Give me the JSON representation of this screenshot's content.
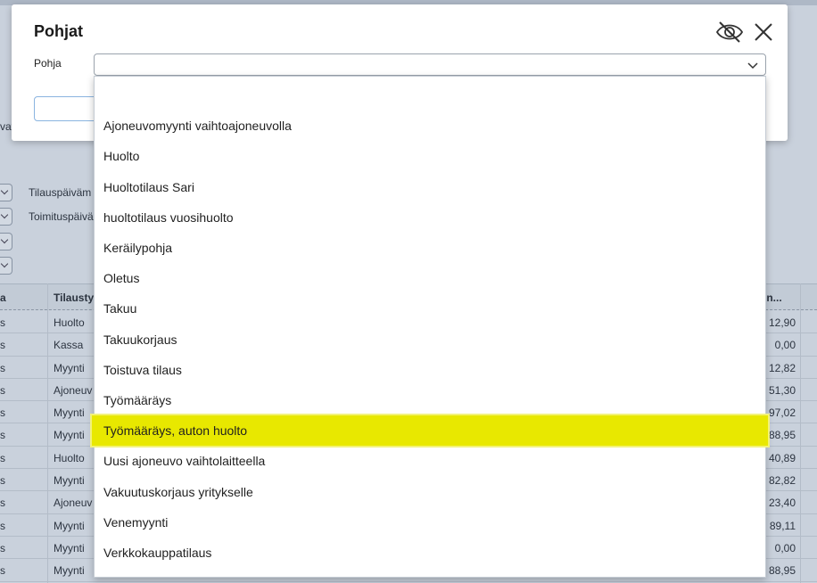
{
  "modal": {
    "title": "Pohjat",
    "field_label": "Pohja",
    "selected_value": "",
    "hide_icon": "eye-off-icon",
    "close_icon": "close-icon"
  },
  "dropdown": {
    "items": [
      "",
      "Ajoneuvomyynti vaihtoajoneuvolla",
      "Huolto",
      "Huoltotilaus Sari",
      "huoltotilaus vuosihuolto",
      "Keräilypohja",
      "Oletus",
      "Takuu",
      "Takuukorjaus",
      "Toistuva tilaus",
      "Työmääräys",
      "Työmääräys, auton huolto",
      "Uusi ajoneuvo vaihtolaitteella",
      "Vakuutuskorjaus yritykselle",
      "Venemyynti",
      "Verkkokauppatilaus"
    ],
    "highlighted_index": 11,
    "highlight_color": "#e8e800"
  },
  "background": {
    "vat_fragment": "vat",
    "filters": [
      "Tilauspäiväm",
      "Toimituspäivä",
      "",
      ""
    ],
    "table_head": {
      "col0": "a",
      "col1": "Tilausty",
      "col2": "een..."
    },
    "rows": [
      {
        "c0": "s",
        "c1": "Huolto",
        "c2": "12,90"
      },
      {
        "c0": "s",
        "c1": "Kassa",
        "c2": "0,00"
      },
      {
        "c0": "s",
        "c1": "Myynti",
        "c2": "12,82"
      },
      {
        "c0": "s",
        "c1": "Ajoneuv",
        "c2": "51,30"
      },
      {
        "c0": "s",
        "c1": "Myynti",
        "c2": "97,02"
      },
      {
        "c0": "s",
        "c1": "Myynti",
        "c2": "88,95"
      },
      {
        "c0": "s",
        "c1": "Huolto",
        "c2": "40,89"
      },
      {
        "c0": "s",
        "c1": "Myynti",
        "c2": "82,82"
      },
      {
        "c0": "s",
        "c1": "Ajoneuv",
        "c2": "23,40"
      },
      {
        "c0": "s",
        "c1": "Myynti",
        "c2": "89,11"
      },
      {
        "c0": "s",
        "c1": "Myynti",
        "c2": "0,00"
      },
      {
        "c0": "s",
        "c1": "Myynti",
        "c2": "88,95"
      }
    ]
  }
}
